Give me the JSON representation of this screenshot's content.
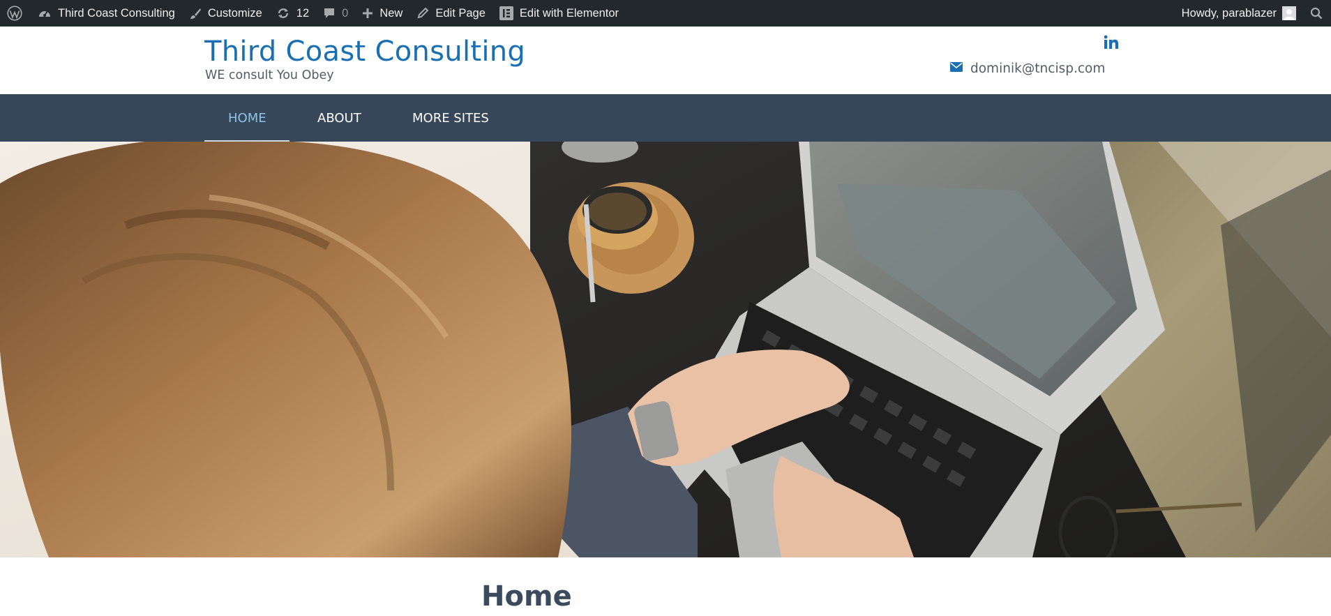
{
  "adminbar": {
    "site_name": "Third Coast Consulting",
    "customize": "Customize",
    "updates_count": "12",
    "comments_count": "0",
    "new_label": "New",
    "edit_page": "Edit Page",
    "edit_elementor": "Edit with Elementor",
    "howdy": "Howdy, parablazer"
  },
  "header": {
    "title": "Third Coast Consulting",
    "tagline": "WE consult You Obey",
    "email": "dominik@tncisp.com"
  },
  "nav": {
    "items": [
      {
        "label": "HOME",
        "active": true
      },
      {
        "label": "ABOUT",
        "active": false
      },
      {
        "label": "MORE SITES",
        "active": false
      }
    ]
  },
  "content": {
    "heading": "Home"
  },
  "colors": {
    "adminbar_bg": "#23282d",
    "title_blue": "#1a6fb3",
    "nav_bg": "#364759",
    "nav_active": "#8dc3e8"
  }
}
